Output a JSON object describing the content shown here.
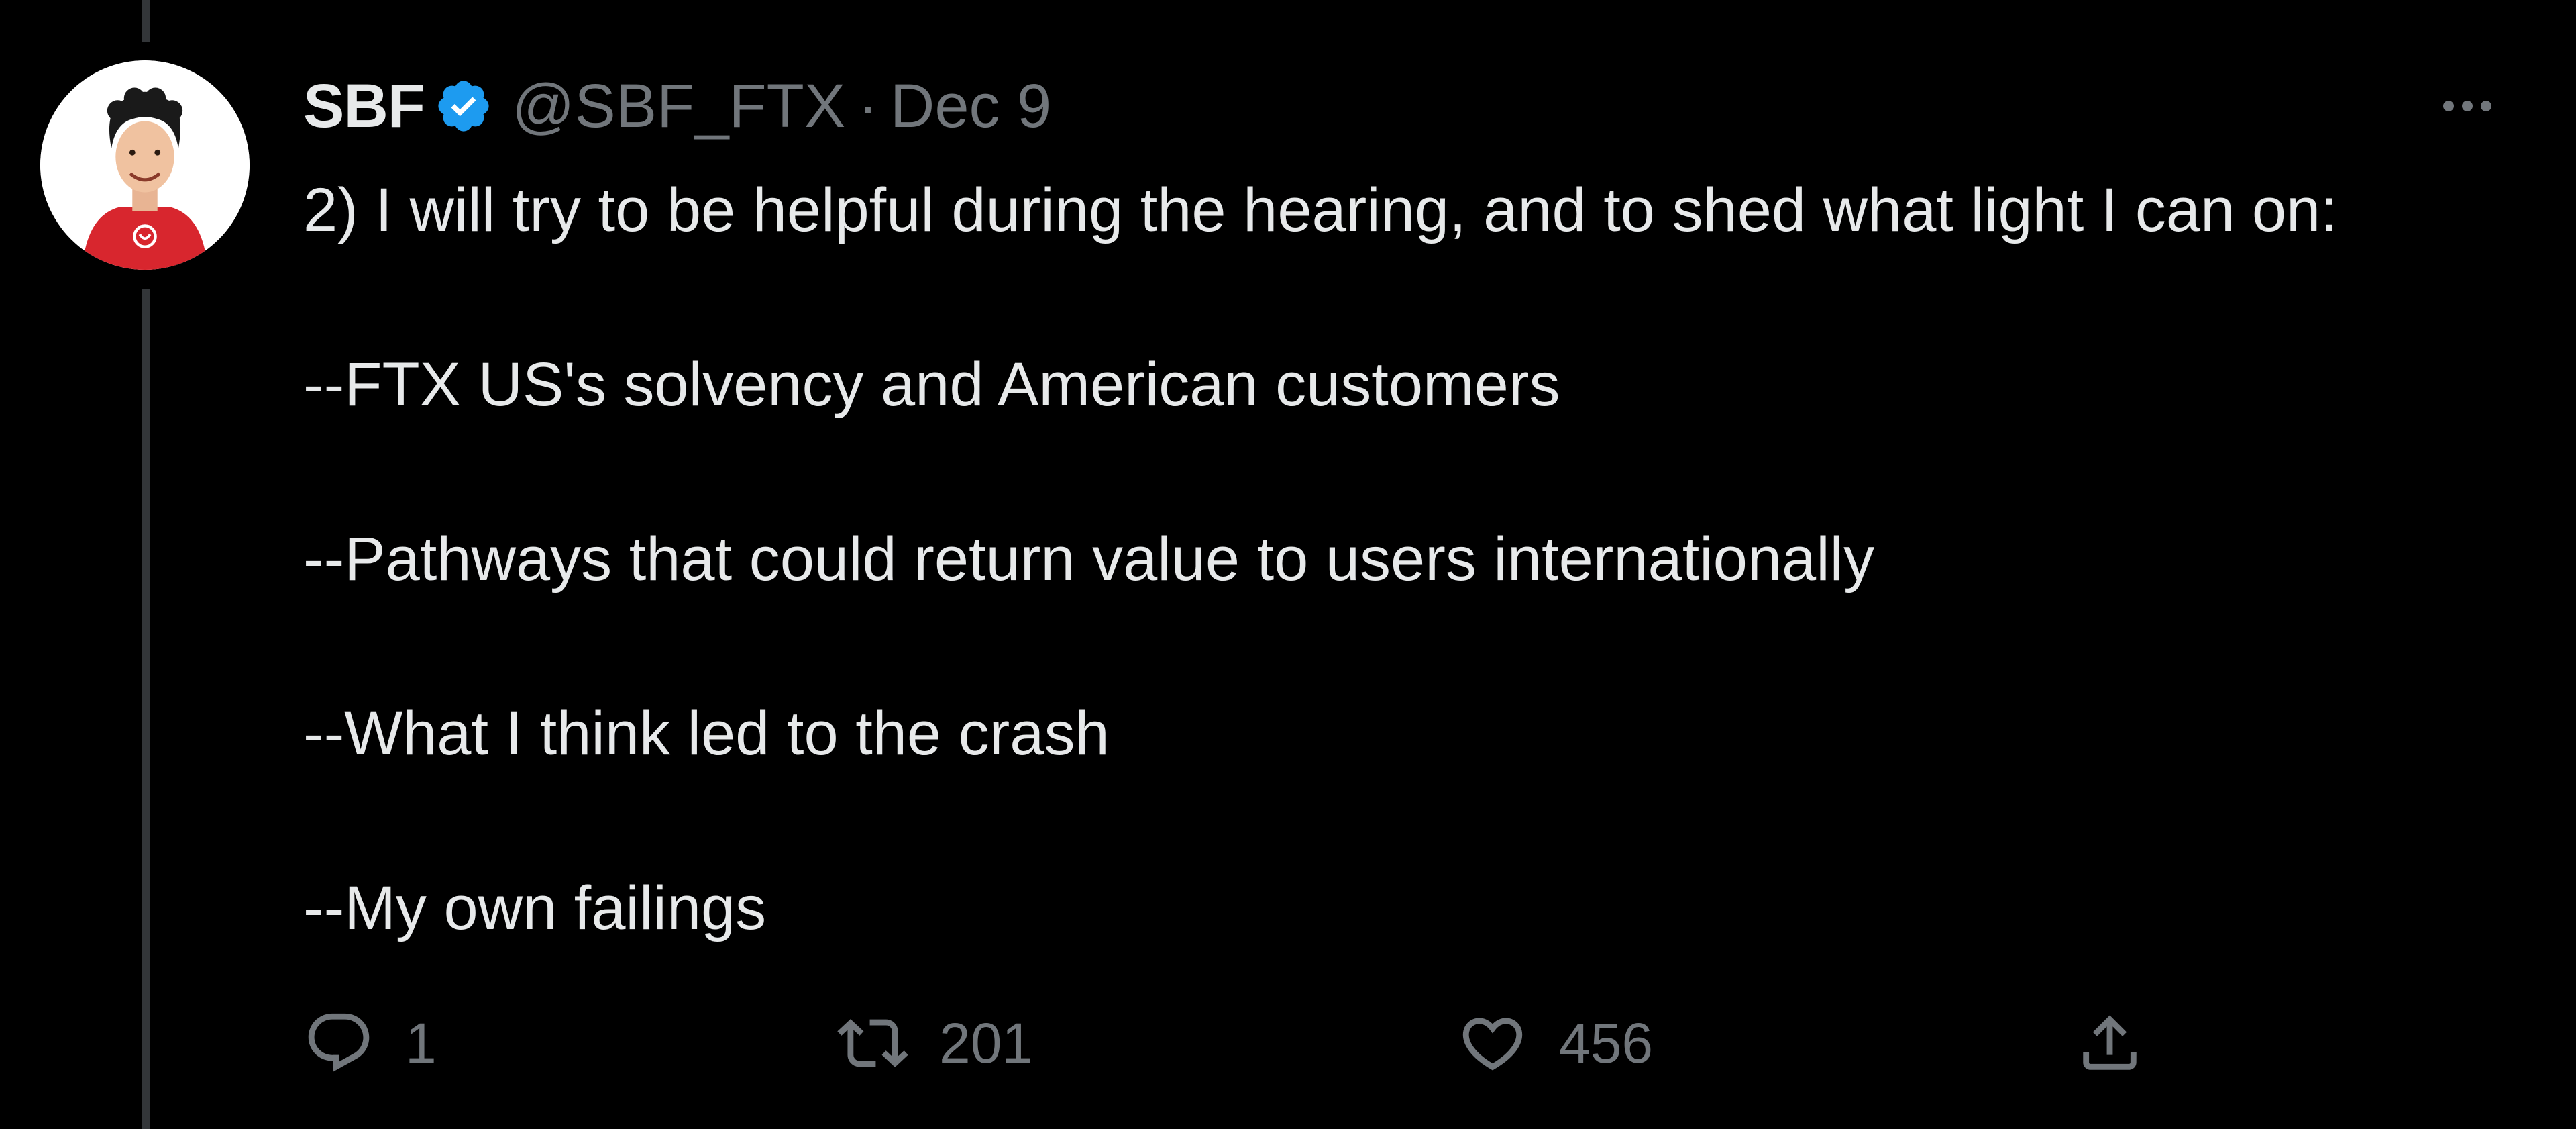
{
  "tweet": {
    "author": {
      "display_name": "SBF",
      "handle": "@SBF_FTX",
      "verified": true,
      "avatar_icon": "avatar-illustration"
    },
    "separator": "·",
    "date": "Dec 9",
    "text": {
      "intro": "2) I will try to be helpful during the hearing, and to shed what light I can on:",
      "points": [
        "--FTX US's solvency and American customers",
        "--Pathways that could return value to users internationally",
        "--What I think led to the crash",
        "--My own failings"
      ]
    },
    "actions": {
      "reply": {
        "icon": "reply-icon",
        "count": "1"
      },
      "retweet": {
        "icon": "retweet-icon",
        "count": "201"
      },
      "like": {
        "icon": "heart-icon",
        "count": "456"
      },
      "share": {
        "icon": "share-icon"
      }
    },
    "more_icon": "more-icon"
  },
  "colors": {
    "background": "#000000",
    "text_primary": "#e7e9ea",
    "text_secondary": "#71767b",
    "verified_blue": "#1d9bf0",
    "thread_line": "#333639"
  }
}
